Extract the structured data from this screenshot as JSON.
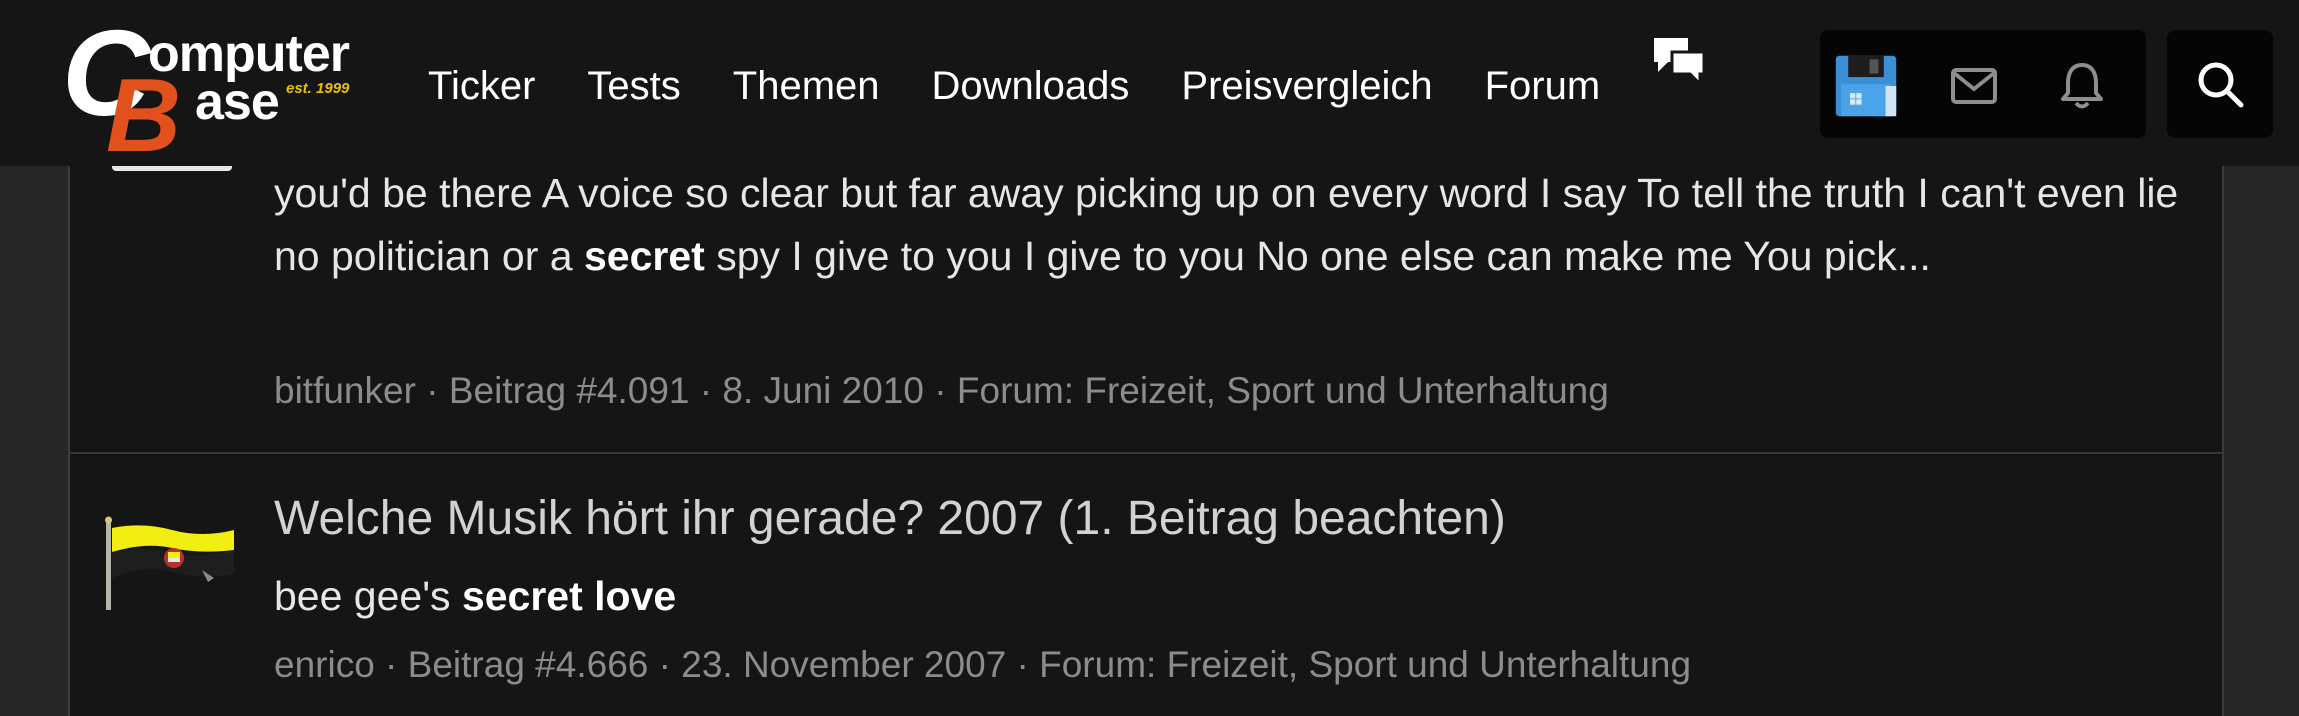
{
  "site": {
    "logo": {
      "letter_c": "C",
      "letter_b": "B",
      "word_top": "omputer",
      "word_bottom": "ase",
      "est": "est. 1999",
      "brand_color": "#e2501c",
      "est_color": "#e8c200"
    }
  },
  "nav": {
    "items": [
      {
        "label": "Ticker"
      },
      {
        "label": "Tests"
      },
      {
        "label": "Themen"
      },
      {
        "label": "Downloads"
      },
      {
        "label": "Preisvergleich"
      },
      {
        "label": "Forum"
      }
    ],
    "forum_icon": "speech-bubbles-icon"
  },
  "toolbar": {
    "icons": [
      "floppy-disk-icon",
      "envelope-icon",
      "bell-icon",
      "search-icon"
    ]
  },
  "results": [
    {
      "excerpt_parts": [
        "you'd be there A voice so clear but far away picking up on every word I say To tell the truth I can't even lie no politician or a ",
        "secret",
        " spy I give to you I give to you No one else can make me You pick..."
      ],
      "meta": {
        "author": "bitfunker",
        "post": "Beitrag #4.091",
        "date": "8. Juni 2010",
        "forum": "Forum: Freizeit, Sport und Unterhaltung"
      }
    },
    {
      "title": "Welche Musik hört ihr gerade? 2007 (1. Beitrag beachten)",
      "snippet_normal": "bee gee's ",
      "snippet_bold": "secret love",
      "meta": {
        "author": "enrico",
        "post": "Beitrag #4.666",
        "date": "23. November 2007",
        "forum": "Forum: Freizeit, Sport und Unterhaltung"
      }
    }
  ],
  "meta_separator": " · "
}
